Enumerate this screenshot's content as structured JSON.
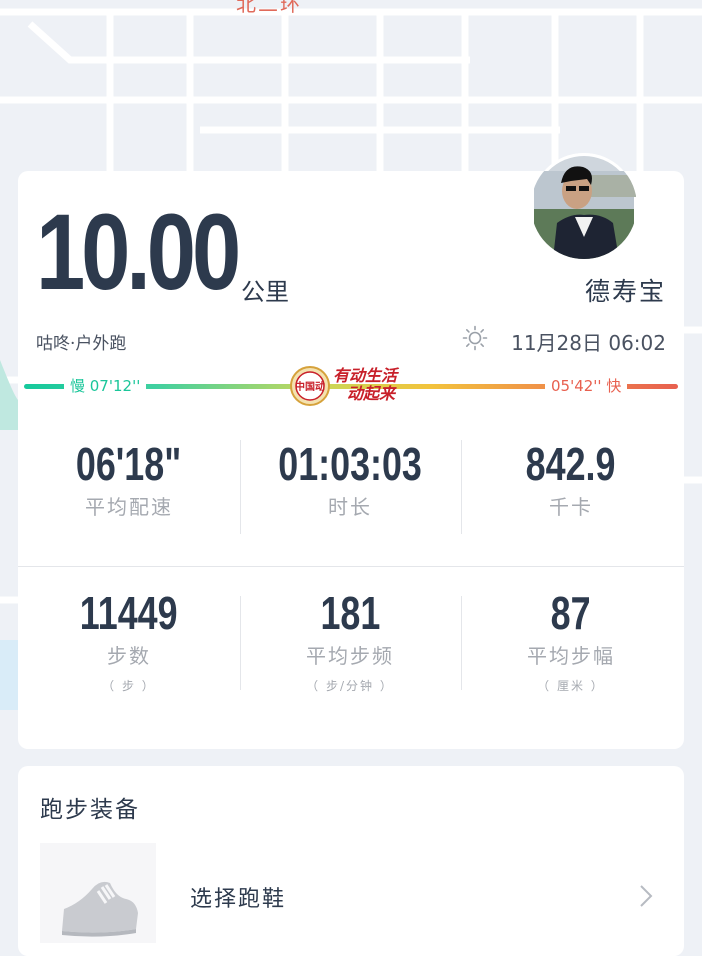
{
  "map": {
    "road_label": "北二环"
  },
  "workout": {
    "distance": "10.00",
    "distance_unit": "公里",
    "user_name": "德寿宝",
    "source": "咕咚·户外跑",
    "datetime": "11月28日 06:02",
    "weather_icon": "sun-icon"
  },
  "pace_scale": {
    "slow": "慢 07'12''",
    "fast": "05'42'' 快",
    "slow_color": "#16c99c",
    "fast_color": "#e8604f"
  },
  "slogan": {
    "line1": "有动生活",
    "line2": "动起来",
    "badge_text": "中国动",
    "color": "#c8202a"
  },
  "stats_row1": [
    {
      "value": "06'18\"",
      "label": "平均配速"
    },
    {
      "value": "01:03:03",
      "label": "时长"
    },
    {
      "value": "842.9",
      "label": "千卡"
    }
  ],
  "stats_row2": [
    {
      "value": "11449",
      "label": "步数",
      "unit": "（ 步 ）"
    },
    {
      "value": "181",
      "label": "平均步频",
      "unit": "（ 步/分钟 ）"
    },
    {
      "value": "87",
      "label": "平均步幅",
      "unit": "（ 厘米 ）"
    }
  ],
  "gear": {
    "title": "跑步装备",
    "select_shoe_label": "选择跑鞋",
    "shoe_icon": "running-shoe-icon",
    "chevron_icon": "chevron-right-icon"
  },
  "colors": {
    "text_dark": "#2d3a4d",
    "text_muted": "#a5a9b0",
    "background": "#eef1f6"
  }
}
